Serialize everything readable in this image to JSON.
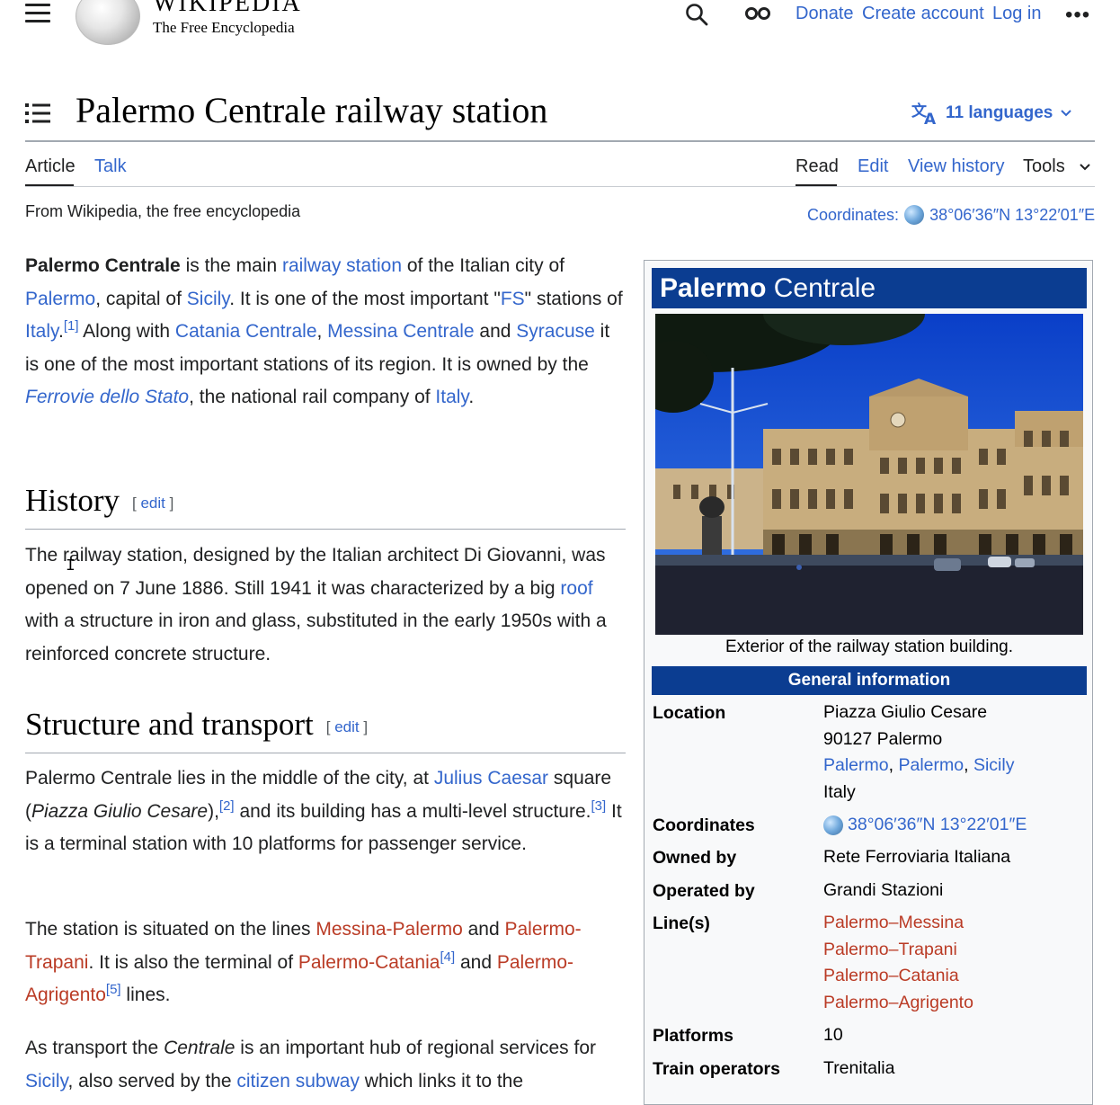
{
  "header": {
    "logo_word": "WIKIPEDIA",
    "logo_tagline": "The Free Encyclopedia",
    "links": [
      "Donate",
      "Create account",
      "Log in"
    ]
  },
  "title": {
    "text": "Palermo Centrale railway station",
    "languages": "11 languages"
  },
  "tabs": {
    "left": [
      "Article",
      "Talk"
    ],
    "right": [
      "Read",
      "Edit",
      "View history",
      "Tools"
    ]
  },
  "tagline": "From Wikipedia, the free encyclopedia",
  "coordinates_top": {
    "label": "Coordinates:",
    "value": "38°06′36″N 13°22′01″E"
  },
  "article": {
    "intro": {
      "bold_name": "Palermo Centrale",
      "t1": " is the main ",
      "l_railway_station": "railway station",
      "t2": " of the Italian city of ",
      "l_palermo": "Palermo",
      "t3": ", capital of ",
      "l_sicily": "Sicily",
      "t4": ". It is one of the most important \"",
      "l_fs": "FS",
      "t5": "\" stations of ",
      "l_italy": "Italy",
      "t6": ".",
      "ref1": "[1]",
      "t7": " Along with ",
      "l_catania": "Catania Centrale",
      "t8": ", ",
      "l_messina": "Messina Centrale",
      "t9": " and ",
      "l_syracuse": "Syracuse",
      "t10": " it is one of the most important stations of its region. It is owned by the ",
      "l_fds": "Ferrovie dello Stato",
      "t11": ", the national rail company of ",
      "l_italy2": "Italy",
      "t12": "."
    },
    "history": {
      "heading": "History",
      "edit": "edit",
      "t1": "The railway station, designed by the Italian architect Di Giovanni, was opened on 7 June 1886. Still 1941 it was characterized by a big ",
      "l_roof": "roof",
      "t2": " with a structure in iron and glass, substituted in the early 1950s with a reinforced concrete structure."
    },
    "structure": {
      "heading": "Structure and transport",
      "edit": "edit",
      "p1_t1": "Palermo Centrale lies in the middle of the city, at ",
      "p1_l_julius": "Julius Caesar",
      "p1_t2": " square (",
      "p1_italic": "Piazza Giulio Cesare",
      "p1_t3": "),",
      "p1_ref2": "[2]",
      "p1_t4": " and its building has a multi-level structure.",
      "p1_ref3": "[3]",
      "p1_t5": " It is a terminal station with 10 platforms for passenger service.",
      "p2_t1": "The station is situated on the lines ",
      "p2_l_mp": "Messina-Palermo",
      "p2_t2": " and ",
      "p2_l_pt": "Palermo-Trapani",
      "p2_t3": ". It is also the terminal of ",
      "p2_l_pc": "Palermo-Catania",
      "p2_ref4": "[4]",
      "p2_t4": " and ",
      "p2_l_pa": "Palermo-Agrigento",
      "p2_ref5": "[5]",
      "p2_t5": " lines.",
      "p3_t1": "As transport the ",
      "p3_italic": "Centrale",
      "p3_t2": " is an important hub of regional services for ",
      "p3_l_sicily": "Sicily",
      "p3_t3": ", also served by the ",
      "p3_l_subway": "citizen subway",
      "p3_t4": " which links it to the"
    }
  },
  "infobox": {
    "title_bold": "Palermo",
    "title_rest": " Centrale",
    "caption": "Exterior of the railway station building.",
    "section": "General information",
    "location_label": "Location",
    "location_lines": [
      "Piazza Giulio Cesare",
      "90127 Palermo"
    ],
    "location_links": [
      "Palermo",
      "Palermo",
      "Sicily"
    ],
    "location_country": "Italy",
    "coordinates_label": "Coordinates",
    "coordinates_value": "38°06′36″N 13°22′01″E",
    "owned_label": "Owned by",
    "owned_value": "Rete Ferroviaria Italiana",
    "operated_label": "Operated by",
    "operated_value": "Grandi Stazioni",
    "lines_label": "Line(s)",
    "lines": [
      "Palermo–Messina",
      "Palermo–Trapani",
      "Palermo–Catania",
      "Palermo–Agrigento"
    ],
    "platforms_label": "Platforms",
    "platforms_value": "10",
    "train_label": "Train operators",
    "train_value": "Trenitalia"
  },
  "colors": {
    "link": "#3366cc",
    "redlink": "#ba3b25",
    "infobox_header": "#0b3d91"
  }
}
